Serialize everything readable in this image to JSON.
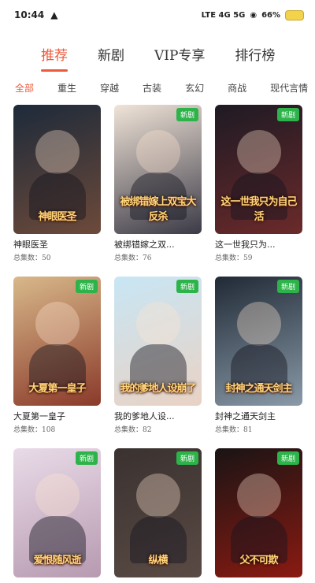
{
  "status_bar": {
    "time": "10:44",
    "network": "LTE 4G 5G",
    "battery": "66%"
  },
  "tabs": [
    "推荐",
    "新剧",
    "VIP专享",
    "排行榜"
  ],
  "categories": [
    "全部",
    "重生",
    "穿越",
    "古装",
    "玄幻",
    "商战",
    "现代言情"
  ],
  "badge_label": "新剧",
  "dramas": [
    {
      "poster_text": "神眼医圣",
      "title": "神眼医圣",
      "count": "总集数：50",
      "colors": [
        "#1d2a3a",
        "#6d4a3a"
      ]
    },
    {
      "poster_text": "被绑错嫁上双宝大反杀",
      "title": "被绑错嫁之双...",
      "count": "总集数：76",
      "colors": [
        "#f0e4d8",
        "#3b3a46"
      ]
    },
    {
      "poster_text": "这一世我只为自己活",
      "title": "这一世我只为...",
      "count": "总集数：59",
      "colors": [
        "#1e1a24",
        "#6b2a2a"
      ]
    },
    {
      "poster_text": "大夏第一皇子",
      "title": "大夏第一皇子",
      "count": "总集数：108",
      "colors": [
        "#d8b88a",
        "#8a3a2a"
      ]
    },
    {
      "poster_text": "我的爹地人设崩了",
      "title": "我的爹地人设...",
      "count": "总集数：82",
      "colors": [
        "#c8e6f5",
        "#e9d2c4"
      ]
    },
    {
      "poster_text": "封神之通天剑主",
      "title": "封神之通天剑主",
      "count": "总集数：81",
      "colors": [
        "#202a36",
        "#8a9aa8"
      ]
    },
    {
      "poster_text": "爱恨随风逝",
      "title": "",
      "count": "",
      "colors": [
        "#e9dbe8",
        "#b79ab0"
      ]
    },
    {
      "poster_text": "纵横",
      "title": "",
      "count": "",
      "colors": [
        "#3a3230",
        "#5a4a44"
      ]
    },
    {
      "poster_text": "父不可欺",
      "title": "",
      "count": "",
      "colors": [
        "#1a1414",
        "#8a1a12"
      ]
    }
  ]
}
